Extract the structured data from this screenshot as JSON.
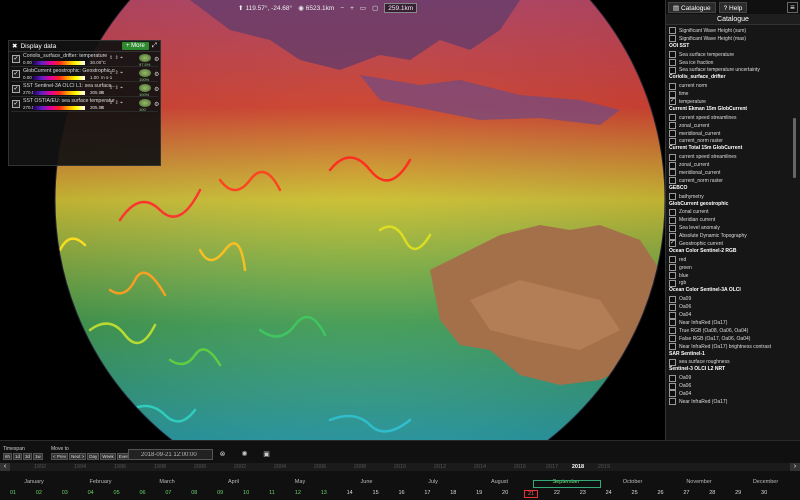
{
  "toolbar": {
    "coords": "119.57°, -24.68°",
    "distance": "6523.1km",
    "scale": "259.1km"
  },
  "display_panel": {
    "title": "Display data",
    "more_label": "+ More",
    "layers": [
      {
        "name": "Coriolis_surface_drifter: temperature",
        "lo": "0.00",
        "hi": "30.00",
        "unit": "°C",
        "count": "97.5%",
        "checked": true
      },
      {
        "name": "GlobCurrent geostrophic: Geostrophic current",
        "lo": "0.00",
        "hi": "1.00",
        "unit": "m s-1",
        "count": "100%",
        "checked": true
      },
      {
        "name": "SST Sentinel-3A OLCI L1: sea surface...",
        "lo": "270.00",
        "hi": "305.00",
        "unit": "K",
        "count": "100%",
        "checked": true
      },
      {
        "name": "SST OSTIA/EU: sea surface temperature",
        "lo": "270.00",
        "hi": "305.00",
        "unit": "K",
        "count": "100",
        "checked": true
      }
    ]
  },
  "catalogue": {
    "tab_catalogue": "Catalogue",
    "tab_help": "Help",
    "title": "Catalogue",
    "rows": [
      {
        "kind": "item",
        "label": "Significant Wave Height (sum)",
        "checked": false
      },
      {
        "kind": "item",
        "label": "Significant Wave Height (max)",
        "checked": false
      },
      {
        "kind": "group",
        "label": "OOI SST"
      },
      {
        "kind": "item",
        "label": "Sea surface temperature",
        "checked": false
      },
      {
        "kind": "item",
        "label": "Sea ice fraction",
        "checked": false
      },
      {
        "kind": "item",
        "label": "Sea surface temperature uncertainty",
        "checked": false
      },
      {
        "kind": "group",
        "label": "Coriolis_surface_drifter"
      },
      {
        "kind": "item",
        "label": "current norm",
        "checked": false
      },
      {
        "kind": "item",
        "label": "time",
        "checked": false
      },
      {
        "kind": "item",
        "label": "temperature",
        "checked": true
      },
      {
        "kind": "group",
        "label": "Current Ekman 15m GlobCurrent"
      },
      {
        "kind": "item",
        "label": "current speed streamlines",
        "checked": false
      },
      {
        "kind": "item",
        "label": "zonal_current",
        "checked": false
      },
      {
        "kind": "item",
        "label": "meridional_current",
        "checked": false
      },
      {
        "kind": "item",
        "label": "current_norm raster",
        "checked": false
      },
      {
        "kind": "group",
        "label": "Current Total 15m GlobCurrent"
      },
      {
        "kind": "item",
        "label": "current speed streamlines",
        "checked": false
      },
      {
        "kind": "item",
        "label": "zonal_current",
        "checked": false
      },
      {
        "kind": "item",
        "label": "meridional_current",
        "checked": false
      },
      {
        "kind": "item",
        "label": "current_norm raster",
        "checked": false
      },
      {
        "kind": "group",
        "label": "GEBCO"
      },
      {
        "kind": "item",
        "label": "bathymetry",
        "checked": false
      },
      {
        "kind": "group",
        "label": "GlobCurrent geostrophic"
      },
      {
        "kind": "item",
        "label": "Zonal current",
        "checked": false
      },
      {
        "kind": "item",
        "label": "Meridian current",
        "checked": false
      },
      {
        "kind": "item",
        "label": "Sea level anomaly",
        "checked": false
      },
      {
        "kind": "item",
        "label": "Absolute Dynamic Topography",
        "checked": false
      },
      {
        "kind": "item",
        "label": "Geostrophic current",
        "checked": true
      },
      {
        "kind": "group",
        "label": "Ocean Color Sentinel-2 RGB"
      },
      {
        "kind": "item",
        "label": "red",
        "checked": false
      },
      {
        "kind": "item",
        "label": "green",
        "checked": false
      },
      {
        "kind": "item",
        "label": "blue",
        "checked": false
      },
      {
        "kind": "item",
        "label": "rgb",
        "checked": false
      },
      {
        "kind": "group",
        "label": "Ocean Color Sentinel-3A OLCI"
      },
      {
        "kind": "item",
        "label": "Oa09",
        "checked": false
      },
      {
        "kind": "item",
        "label": "Oa06",
        "checked": false
      },
      {
        "kind": "item",
        "label": "Oa04",
        "checked": false
      },
      {
        "kind": "item",
        "label": "Near InfraRed (Oa17)",
        "checked": false
      },
      {
        "kind": "item",
        "label": "True RGB (Oa08, Oa06, Oa04)",
        "checked": false
      },
      {
        "kind": "item",
        "label": "False RGB (Oa17, Oa06, Oa04)",
        "checked": false
      },
      {
        "kind": "item",
        "label": "Near InfraRed (Oa17) brightness contrast",
        "checked": false
      },
      {
        "kind": "group",
        "label": "SAR Sentinel-1"
      },
      {
        "kind": "item",
        "label": "sea surface roughness",
        "checked": false
      },
      {
        "kind": "group",
        "label": "Sentinel-3 OLCI L2 NRT"
      },
      {
        "kind": "item",
        "label": "Oa09",
        "checked": false
      },
      {
        "kind": "item",
        "label": "Oa06",
        "checked": false
      },
      {
        "kind": "item",
        "label": "Oa04",
        "checked": false
      },
      {
        "kind": "item",
        "label": "Near InfraRed (Oa17)",
        "checked": false
      }
    ]
  },
  "timeline": {
    "timespan_label": "Timespan",
    "timespan_buttons": [
      "6h",
      "1d",
      "3d",
      "1w"
    ],
    "moveto_label": "Move to",
    "moveto_buttons": [
      "< Prev",
      "Next >",
      "Day",
      "Week",
      "Event"
    ],
    "datetime": "2018-09-21 12:00:00",
    "years": [
      "1992",
      "1994",
      "1996",
      "1998",
      "2000",
      "2002",
      "2004",
      "2006",
      "2008",
      "2010",
      "2012",
      "2014",
      "2016",
      "2017",
      "2018",
      "2019"
    ],
    "selected_year": "2018",
    "months": [
      "January",
      "February",
      "March",
      "April",
      "May",
      "June",
      "July",
      "August",
      "September",
      "October",
      "November",
      "December"
    ],
    "selected_month": "September",
    "days": [
      "01",
      "02",
      "03",
      "04",
      "05",
      "06",
      "07",
      "08",
      "09",
      "10",
      "11",
      "12",
      "13",
      "14",
      "15",
      "16",
      "17",
      "18",
      "19",
      "20",
      "21",
      "22",
      "23",
      "24",
      "25",
      "26",
      "27",
      "28",
      "29",
      "30"
    ],
    "selected_day": "21"
  }
}
